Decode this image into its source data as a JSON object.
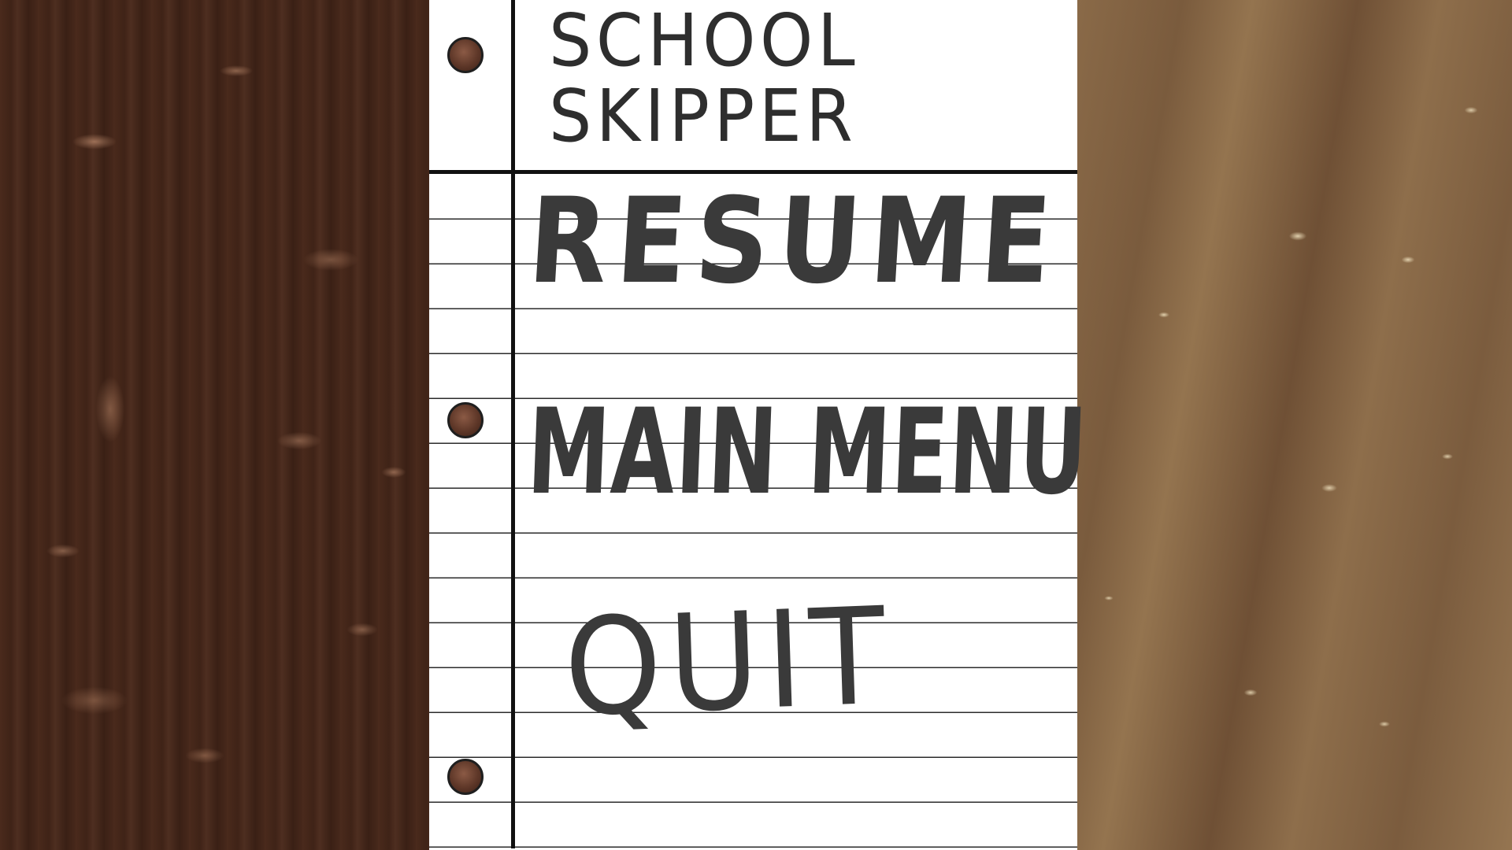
{
  "title": {
    "line1": "SCHOOL",
    "line2": "SKIPPER"
  },
  "pause_menu": {
    "resume_label": "RESUME",
    "main_menu_label": "MAIN MENU",
    "quit_label": "QUIT"
  },
  "colors": {
    "paper": "#ffffff",
    "ink": "#2e2e2e",
    "rule": "#2b2b2b",
    "wood_left": "#432619",
    "wood_right": "#86664a"
  }
}
